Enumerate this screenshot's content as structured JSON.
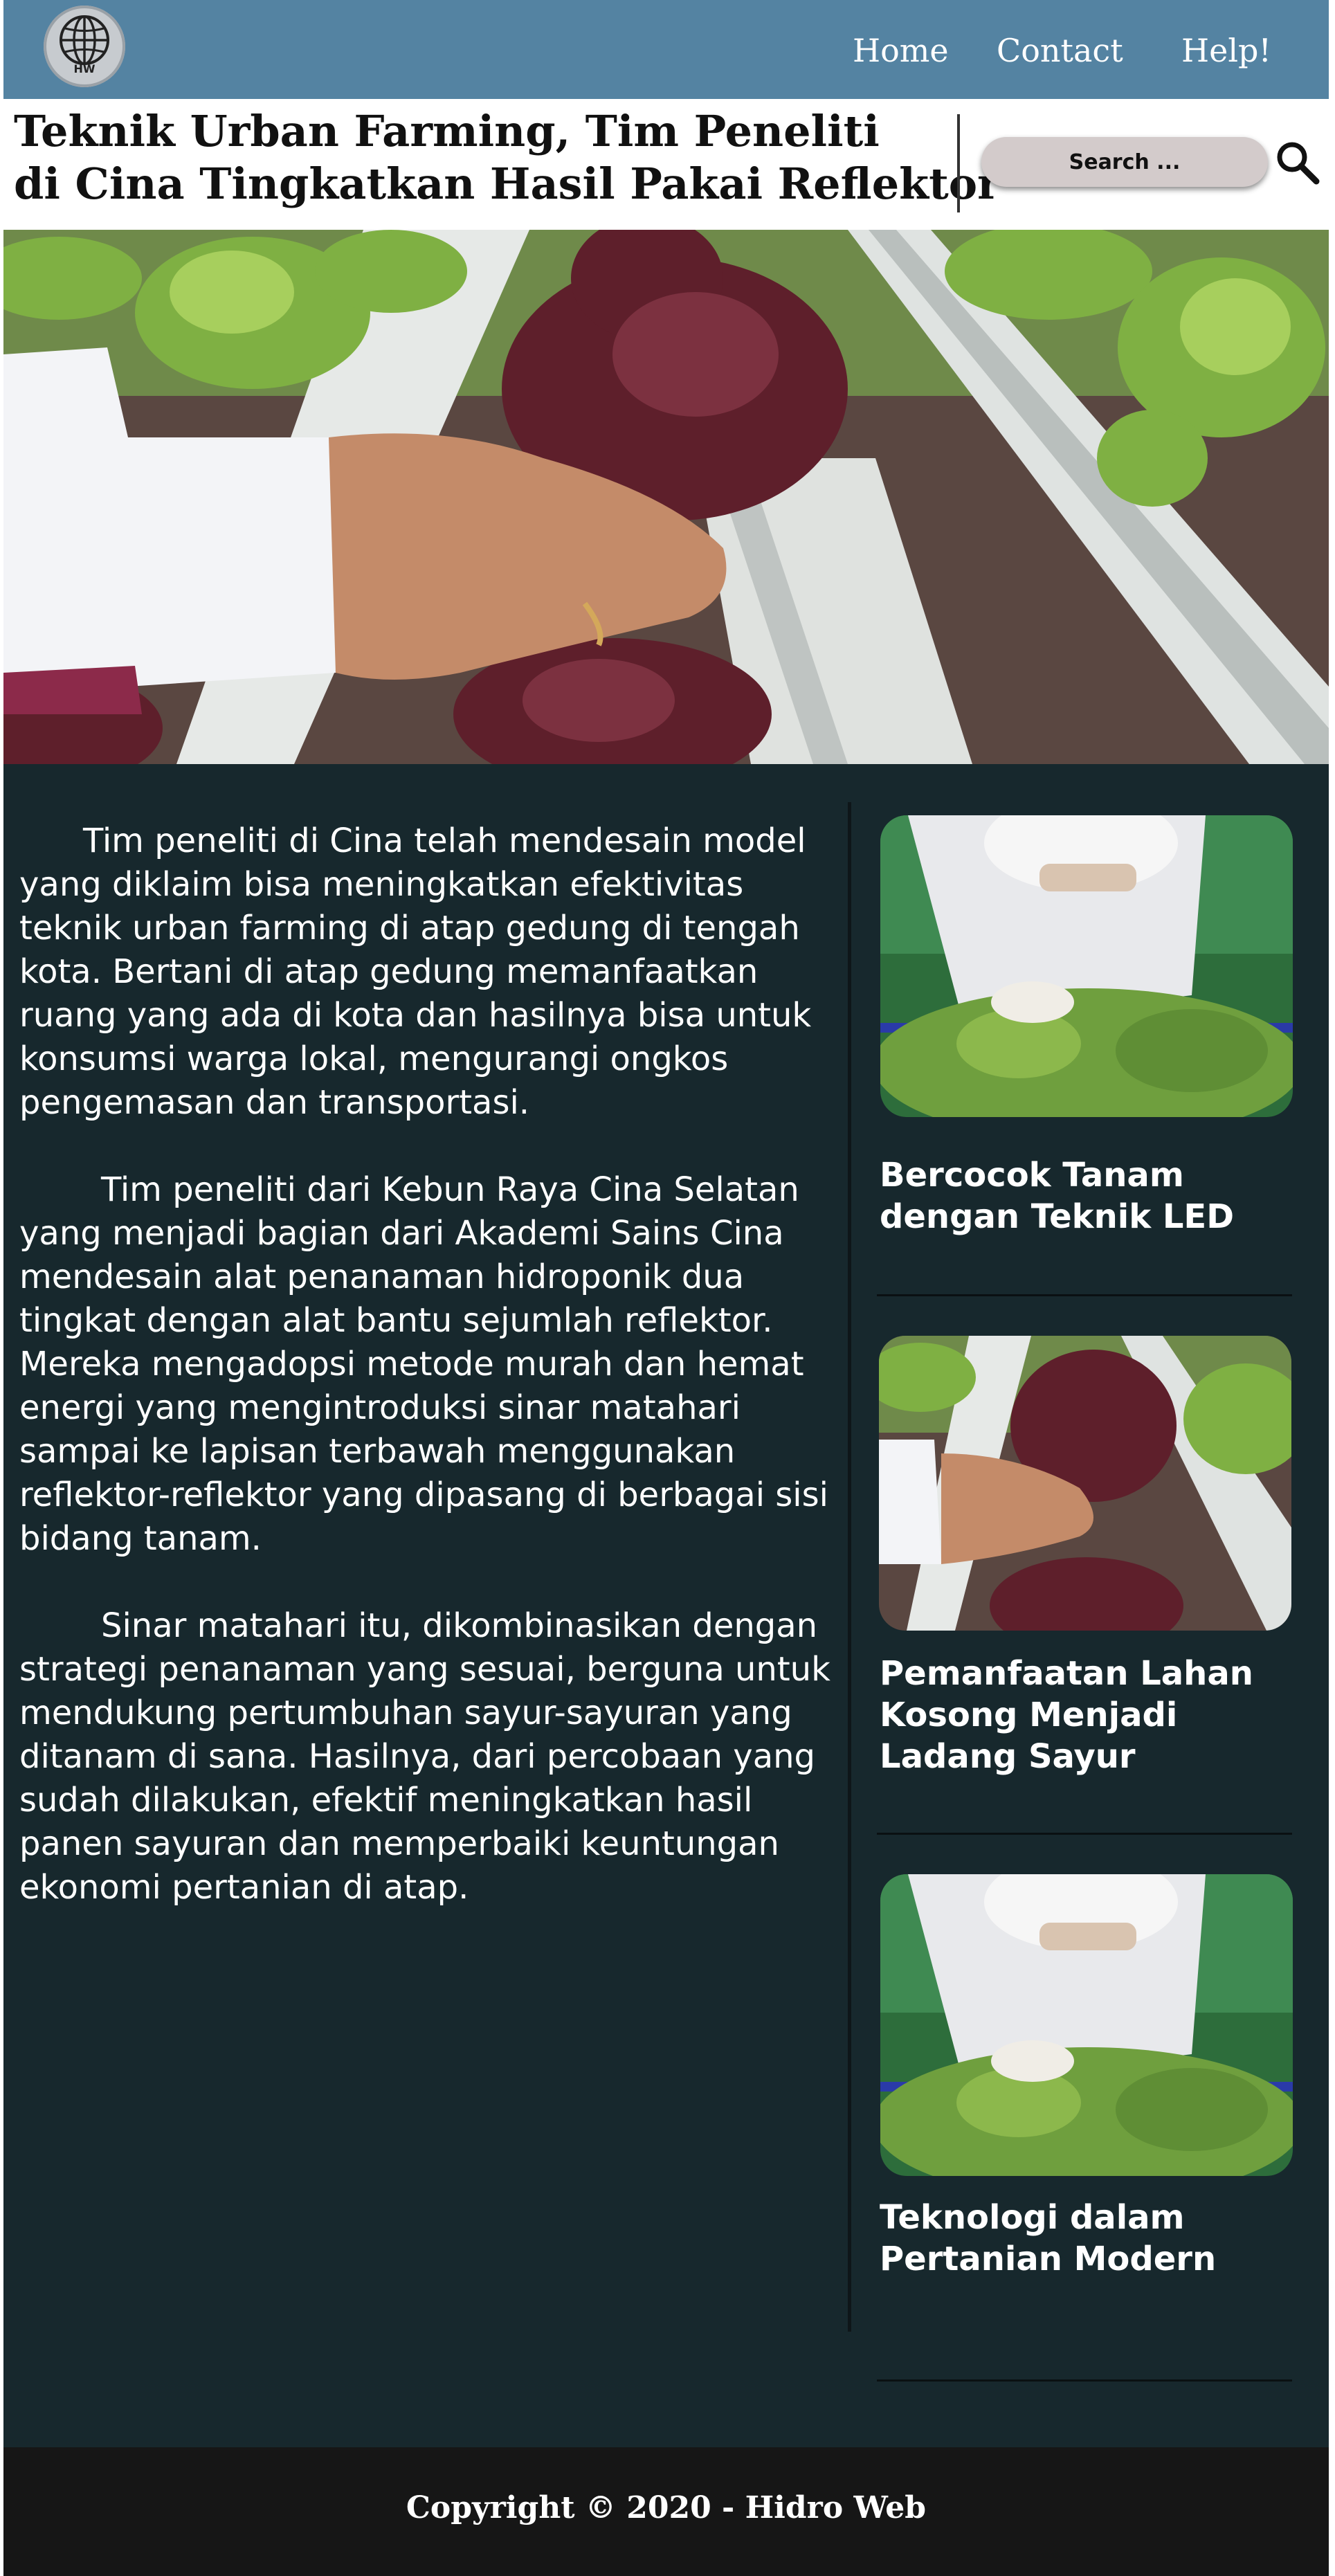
{
  "nav": {
    "logo_text": "HW",
    "links": [
      "Home",
      "Contact",
      "Help!"
    ]
  },
  "header": {
    "title_line1": "Teknik Urban Farming, Tim Peneliti",
    "title_line2": "di Cina Tingkatkan Hasil Pakai Reflektor"
  },
  "search": {
    "placeholder": "Search ..."
  },
  "article": {
    "paragraphs": [
      "Tim peneliti di Cina telah mendesain model yang diklaim bisa meningkatkan efektivitas teknik urban farming di atap gedung di tengah kota. Bertani di atap gedung memanfaatkan ruang yang ada di kota dan hasilnya bisa untuk konsumsi warga lokal, mengurangi ongkos pengemasan dan transportasi.",
      "Tim peneliti dari Kebun Raya Cina Selatan yang menjadi bagian dari Akademi Sains Cina mendesain alat penanaman hidroponik dua tingkat dengan alat bantu sejumlah reflektor. Mereka mengadopsi metode murah dan hemat energi yang mengintroduksi sinar matahari sampai ke lapisan terbawah menggunakan reflektor-reflektor yang dipasang di berbagai sisi bidang tanam.",
      "Sinar matahari itu, dikombinasikan dengan strategi penanaman yang sesuai, berguna untuk mendukung pertumbuhan sayur-sayuran yang ditanam di sana. Hasilnya, dari percobaan yang sudah dilakukan, efektif meningkatkan hasil panen sayuran dan memperbaiki keuntungan ekonomi pertanian di atap."
    ]
  },
  "sidebar": {
    "cards": [
      {
        "title": "Bercocok Tanam dengan Teknik LED"
      },
      {
        "title": "Pemanfaatan Lahan Kosong Menjadi Ladang Sayur"
      },
      {
        "title": "Teknologi dalam Pertanian Modern"
      }
    ]
  },
  "footer": {
    "copyright": "Copyright © 2020 - Hidro Web"
  },
  "colors": {
    "navbar": "#5483a2",
    "content_bg": "#17282d",
    "footer_bg": "#161616",
    "search_bg": "#d3cbcb"
  }
}
